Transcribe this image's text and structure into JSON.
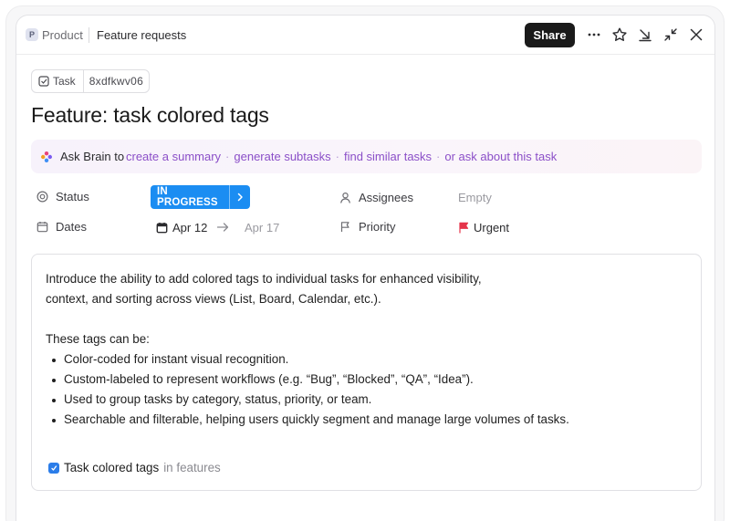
{
  "breadcrumb": {
    "space_initial": "P",
    "space_name": "Product",
    "list_name": "Feature requests"
  },
  "header": {
    "share_label": "Share",
    "icons": [
      "more-icon",
      "star-icon",
      "download-icon",
      "collapse-icon",
      "close-icon"
    ]
  },
  "task": {
    "type_label": "Task",
    "id": "8xdfkwv06",
    "title": "Feature: task colored tags"
  },
  "ask_brain": {
    "label": "Ask Brain to",
    "actions": [
      "create a summary",
      "generate subtasks",
      "find similar tasks",
      "or ask about this task"
    ]
  },
  "fields": {
    "status": {
      "label": "Status",
      "value": "IN PROGRESS",
      "color": "#1b8df2"
    },
    "dates": {
      "label": "Dates",
      "start": "Apr 12",
      "end": "Apr 17"
    },
    "assignees": {
      "label": "Assignees",
      "value": "Empty"
    },
    "priority": {
      "label": "Priority",
      "value": "Urgent",
      "flag_color": "#e5344a"
    }
  },
  "description": {
    "intro_line1": "Introduce the ability to add colored tags to individual tasks for enhanced visibility,",
    "intro_line2": "context, and sorting across views (List, Board, Calendar, etc.).",
    "list_heading": "These tags can be:",
    "bullets": [
      "Color-coded for instant visual recognition.",
      "Custom-labeled to represent workflows (e.g. “Bug”, “Blocked”, “QA”, “Idea”).",
      "Used to group tasks by category, status, priority, or team.",
      "Searchable and filterable, helping users quickly segment and manage large volumes of tasks."
    ],
    "relation": {
      "name": "Task colored tags",
      "location": "in features"
    }
  }
}
